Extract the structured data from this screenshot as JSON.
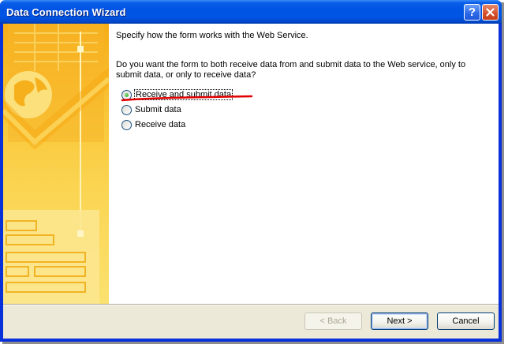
{
  "window": {
    "title": "Data Connection Wizard",
    "help_glyph": "?"
  },
  "content": {
    "intro": "Specify how the form works with the Web Service.",
    "question": "Do you want the form to both receive data from and submit data to the Web service, only to submit data, or only to receive data?"
  },
  "options": [
    {
      "label": "Receive and submit data",
      "selected": true
    },
    {
      "label": "Submit data",
      "selected": false
    },
    {
      "label": "Receive data",
      "selected": false
    }
  ],
  "buttons": {
    "back": "< Back",
    "next": "Next >",
    "cancel": "Cancel"
  },
  "colors": {
    "titlebar": "#0054e3",
    "annotation_underline": "#e00000",
    "banner": "#f9c83a"
  },
  "icons": {
    "help": "help-icon",
    "close": "close-icon",
    "banner": "globe-graphic"
  }
}
